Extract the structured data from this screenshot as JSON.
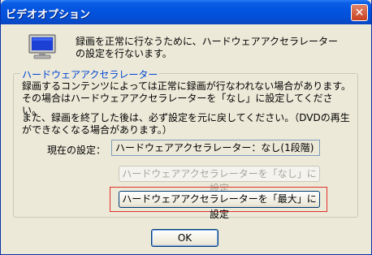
{
  "window": {
    "title": "ビデオオプション",
    "close_glyph": "✕"
  },
  "intro_text": "録画を正常に行なうために、ハードウェアアクセラレーターの設定を行ないます。",
  "group": {
    "legend": "ハードウェアアクセラレーター",
    "paragraph1": "録画するコンテンツによっては正常に録画が行なわれない場合があります。その場合はハードウェアアクセラレーターを「なし」に設定してください。",
    "paragraph2": "また、録画を終了した後は、必ず設定を元に戻してください。（DVDの再生ができなくなる場合があります。）",
    "current_label": "現在の設定：",
    "current_value": "ハードウェアアクセラレーター：なし(1段階)",
    "button_none": "ハードウェアアクセラレーターを「なし」に設定",
    "button_max": "ハードウェアアクセラレーターを「最大」に設定"
  },
  "ok_button": {
    "label": "OK"
  },
  "colors": {
    "titlebar": "#0354e0",
    "legend": "#0046d5",
    "highlight_frame": "#e0302a",
    "dialog_bg": "#ece9d8"
  },
  "icons": {
    "monitor": "monitor-icon",
    "close": "close-icon"
  }
}
